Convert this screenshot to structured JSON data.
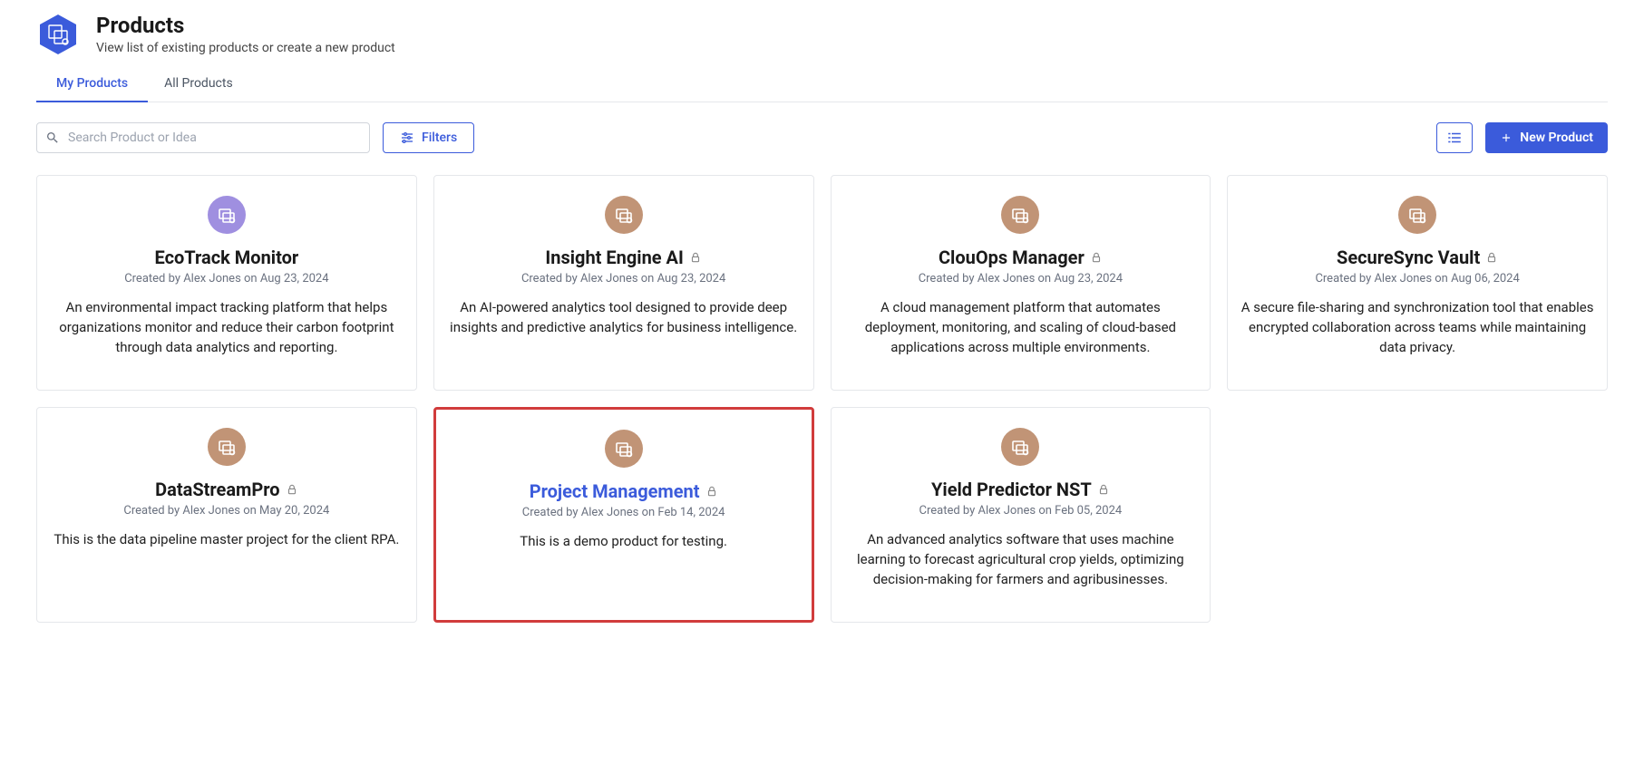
{
  "header": {
    "title": "Products",
    "subtitle": "View list of existing products or create a new product"
  },
  "tabs": [
    {
      "label": "My Products",
      "active": true
    },
    {
      "label": "All Products",
      "active": false
    }
  ],
  "toolbar": {
    "search_placeholder": "Search Product or Idea",
    "filters_label": "Filters",
    "new_product_label": "New Product"
  },
  "icon_colors": {
    "purple": "#9f8fe0",
    "brown": "#c19476"
  },
  "products": [
    {
      "title": "EcoTrack Monitor",
      "meta": "Created by Alex Jones on Aug 23, 2024",
      "description": "An environmental impact tracking platform that helps organizations monitor and reduce their carbon footprint through data analytics and reporting.",
      "locked": false,
      "icon_color": "purple",
      "highlighted": false
    },
    {
      "title": "Insight Engine AI",
      "meta": "Created by Alex Jones on Aug 23, 2024",
      "description": "An AI-powered analytics tool designed to provide deep insights and predictive analytics for business intelligence.",
      "locked": true,
      "icon_color": "brown",
      "highlighted": false
    },
    {
      "title": "ClouOps Manager",
      "meta": "Created by Alex Jones on Aug 23, 2024",
      "description": "A cloud management platform that automates deployment, monitoring, and scaling of cloud-based applications across multiple environments.",
      "locked": true,
      "icon_color": "brown",
      "highlighted": false
    },
    {
      "title": "SecureSync Vault",
      "meta": "Created by Alex Jones on Aug 06, 2024",
      "description": "A secure file-sharing and synchronization tool that enables encrypted collaboration across teams while maintaining data privacy.",
      "locked": true,
      "icon_color": "brown",
      "highlighted": false
    },
    {
      "title": "DataStreamPro",
      "meta": "Created by Alex Jones on May 20, 2024",
      "description": "This is the data pipeline master project for the client RPA.",
      "locked": true,
      "icon_color": "brown",
      "highlighted": false
    },
    {
      "title": "Project Management",
      "meta": "Created by Alex Jones on Feb 14, 2024",
      "description": "This is a demo product for testing.",
      "locked": true,
      "icon_color": "brown",
      "highlighted": true
    },
    {
      "title": "Yield Predictor NST",
      "meta": "Created by Alex Jones on Feb 05, 2024",
      "description": "An advanced analytics software that uses machine learning to forecast agricultural crop yields, optimizing decision-making for farmers and agribusinesses.",
      "locked": true,
      "icon_color": "brown",
      "highlighted": false
    }
  ]
}
